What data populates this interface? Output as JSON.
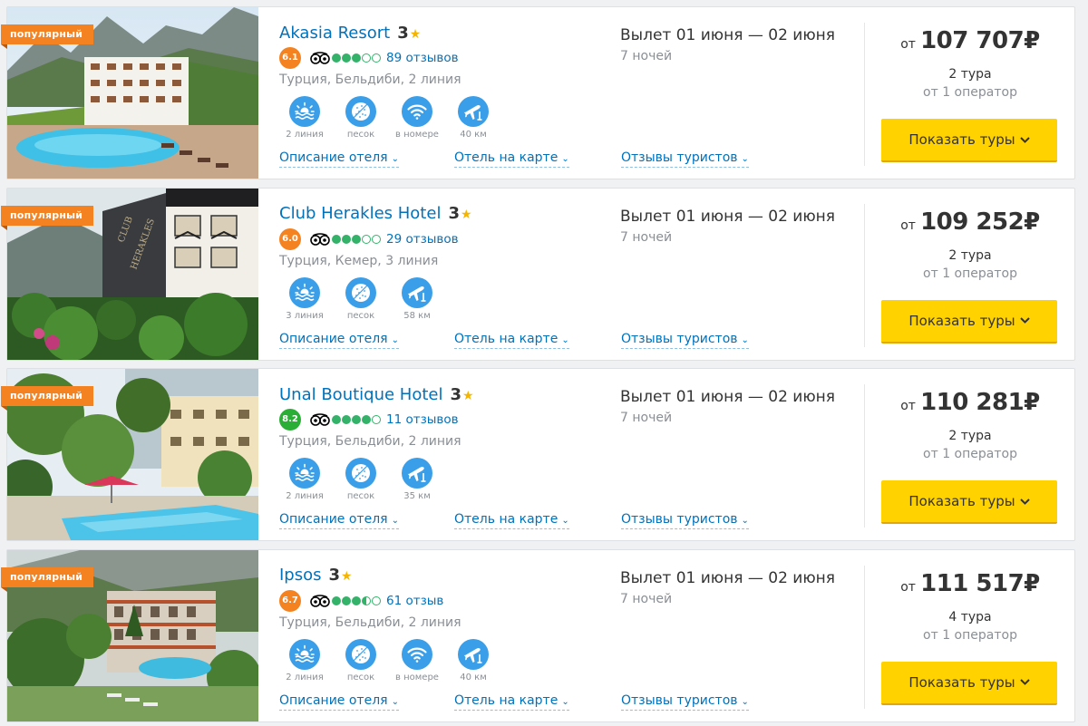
{
  "common": {
    "badge": "популярный",
    "links": [
      "Описание отеля",
      "Отель на карте",
      "Отзывы туристов"
    ],
    "show_tours": "Показать туры",
    "from": "от",
    "ruble": "₽",
    "star_glyph": "★"
  },
  "hotels": [
    {
      "name": "Akasia Resort",
      "stars": "3",
      "score": "6.1",
      "score_color": "#f58220",
      "owl_rating": 3,
      "reviews": "89 отзывов",
      "location": "Турция, Бельдиби, 2 линия",
      "amenities": [
        {
          "icon": "beach-icon",
          "label": "2 линия"
        },
        {
          "icon": "sand-icon",
          "label": "песок"
        },
        {
          "icon": "wifi-icon",
          "label": "в номере"
        },
        {
          "icon": "airport-icon",
          "label": "40 км"
        }
      ],
      "dates": "Вылет 01 июня — 02 июня",
      "nights": "7 ночей",
      "price": "107 707",
      "tours": "2 тура",
      "operator": "от 1 оператор"
    },
    {
      "name": "Club Herakles Hotel",
      "stars": "3",
      "score": "6.0",
      "score_color": "#f58220",
      "owl_rating": 3,
      "reviews": "29 отзывов",
      "location": "Турция, Кемер, 3 линия",
      "amenities": [
        {
          "icon": "beach-icon",
          "label": "3 линия"
        },
        {
          "icon": "sand-icon",
          "label": "песок"
        },
        {
          "icon": "airport-icon",
          "label": "58 км"
        }
      ],
      "dates": "Вылет 01 июня — 02 июня",
      "nights": "7 ночей",
      "price": "109 252",
      "tours": "2 тура",
      "operator": "от 1 оператор"
    },
    {
      "name": "Unal Boutique Hotel",
      "stars": "3",
      "score": "8.2",
      "score_color": "#2bae36",
      "owl_rating": 4,
      "reviews": "11 отзывов",
      "location": "Турция, Бельдиби, 2 линия",
      "amenities": [
        {
          "icon": "beach-icon",
          "label": "2 линия"
        },
        {
          "icon": "sand-icon",
          "label": "песок"
        },
        {
          "icon": "airport-icon",
          "label": "35 км"
        }
      ],
      "dates": "Вылет 01 июня — 02 июня",
      "nights": "7 ночей",
      "price": "110 281",
      "tours": "2 тура",
      "operator": "от 1 оператор"
    },
    {
      "name": "Ipsos",
      "stars": "3",
      "score": "6.7",
      "score_color": "#f58220",
      "owl_rating": 3.5,
      "reviews": "61 отзыв",
      "location": "Турция, Бельдиби, 2 линия",
      "amenities": [
        {
          "icon": "beach-icon",
          "label": "2 линия"
        },
        {
          "icon": "sand-icon",
          "label": "песок"
        },
        {
          "icon": "wifi-icon",
          "label": "в номере"
        },
        {
          "icon": "airport-icon",
          "label": "40 км"
        }
      ],
      "dates": "Вылет 01 июня — 02 июня",
      "nights": "7 ночей",
      "price": "111 517",
      "tours": "4 тура",
      "operator": "от 1 оператор"
    }
  ]
}
